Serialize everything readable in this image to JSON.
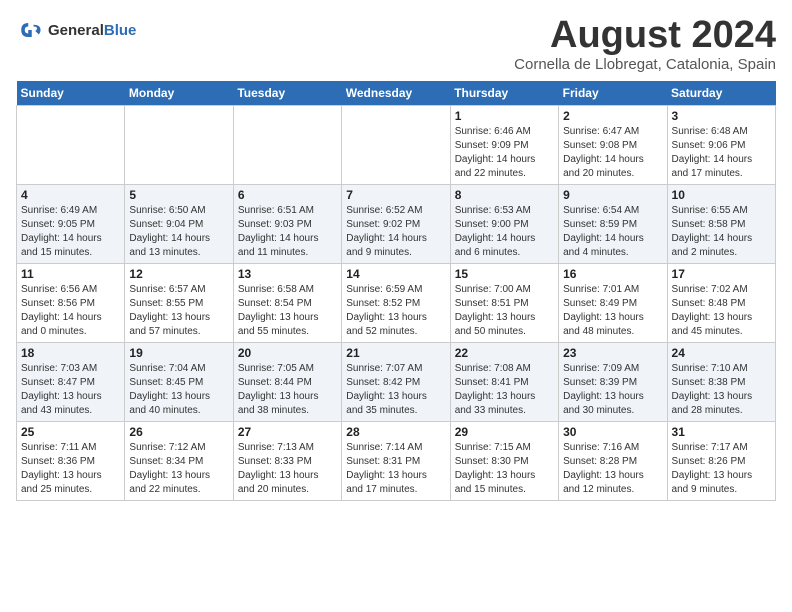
{
  "header": {
    "logo_line1": "General",
    "logo_line2": "Blue",
    "main_title": "August 2024",
    "subtitle": "Cornella de Llobregat, Catalonia, Spain"
  },
  "weekdays": [
    "Sunday",
    "Monday",
    "Tuesday",
    "Wednesday",
    "Thursday",
    "Friday",
    "Saturday"
  ],
  "weeks": [
    [
      {
        "day": "",
        "info": ""
      },
      {
        "day": "",
        "info": ""
      },
      {
        "day": "",
        "info": ""
      },
      {
        "day": "",
        "info": ""
      },
      {
        "day": "1",
        "info": "Sunrise: 6:46 AM\nSunset: 9:09 PM\nDaylight: 14 hours\nand 22 minutes."
      },
      {
        "day": "2",
        "info": "Sunrise: 6:47 AM\nSunset: 9:08 PM\nDaylight: 14 hours\nand 20 minutes."
      },
      {
        "day": "3",
        "info": "Sunrise: 6:48 AM\nSunset: 9:06 PM\nDaylight: 14 hours\nand 17 minutes."
      }
    ],
    [
      {
        "day": "4",
        "info": "Sunrise: 6:49 AM\nSunset: 9:05 PM\nDaylight: 14 hours\nand 15 minutes."
      },
      {
        "day": "5",
        "info": "Sunrise: 6:50 AM\nSunset: 9:04 PM\nDaylight: 14 hours\nand 13 minutes."
      },
      {
        "day": "6",
        "info": "Sunrise: 6:51 AM\nSunset: 9:03 PM\nDaylight: 14 hours\nand 11 minutes."
      },
      {
        "day": "7",
        "info": "Sunrise: 6:52 AM\nSunset: 9:02 PM\nDaylight: 14 hours\nand 9 minutes."
      },
      {
        "day": "8",
        "info": "Sunrise: 6:53 AM\nSunset: 9:00 PM\nDaylight: 14 hours\nand 6 minutes."
      },
      {
        "day": "9",
        "info": "Sunrise: 6:54 AM\nSunset: 8:59 PM\nDaylight: 14 hours\nand 4 minutes."
      },
      {
        "day": "10",
        "info": "Sunrise: 6:55 AM\nSunset: 8:58 PM\nDaylight: 14 hours\nand 2 minutes."
      }
    ],
    [
      {
        "day": "11",
        "info": "Sunrise: 6:56 AM\nSunset: 8:56 PM\nDaylight: 14 hours\nand 0 minutes."
      },
      {
        "day": "12",
        "info": "Sunrise: 6:57 AM\nSunset: 8:55 PM\nDaylight: 13 hours\nand 57 minutes."
      },
      {
        "day": "13",
        "info": "Sunrise: 6:58 AM\nSunset: 8:54 PM\nDaylight: 13 hours\nand 55 minutes."
      },
      {
        "day": "14",
        "info": "Sunrise: 6:59 AM\nSunset: 8:52 PM\nDaylight: 13 hours\nand 52 minutes."
      },
      {
        "day": "15",
        "info": "Sunrise: 7:00 AM\nSunset: 8:51 PM\nDaylight: 13 hours\nand 50 minutes."
      },
      {
        "day": "16",
        "info": "Sunrise: 7:01 AM\nSunset: 8:49 PM\nDaylight: 13 hours\nand 48 minutes."
      },
      {
        "day": "17",
        "info": "Sunrise: 7:02 AM\nSunset: 8:48 PM\nDaylight: 13 hours\nand 45 minutes."
      }
    ],
    [
      {
        "day": "18",
        "info": "Sunrise: 7:03 AM\nSunset: 8:47 PM\nDaylight: 13 hours\nand 43 minutes."
      },
      {
        "day": "19",
        "info": "Sunrise: 7:04 AM\nSunset: 8:45 PM\nDaylight: 13 hours\nand 40 minutes."
      },
      {
        "day": "20",
        "info": "Sunrise: 7:05 AM\nSunset: 8:44 PM\nDaylight: 13 hours\nand 38 minutes."
      },
      {
        "day": "21",
        "info": "Sunrise: 7:07 AM\nSunset: 8:42 PM\nDaylight: 13 hours\nand 35 minutes."
      },
      {
        "day": "22",
        "info": "Sunrise: 7:08 AM\nSunset: 8:41 PM\nDaylight: 13 hours\nand 33 minutes."
      },
      {
        "day": "23",
        "info": "Sunrise: 7:09 AM\nSunset: 8:39 PM\nDaylight: 13 hours\nand 30 minutes."
      },
      {
        "day": "24",
        "info": "Sunrise: 7:10 AM\nSunset: 8:38 PM\nDaylight: 13 hours\nand 28 minutes."
      }
    ],
    [
      {
        "day": "25",
        "info": "Sunrise: 7:11 AM\nSunset: 8:36 PM\nDaylight: 13 hours\nand 25 minutes."
      },
      {
        "day": "26",
        "info": "Sunrise: 7:12 AM\nSunset: 8:34 PM\nDaylight: 13 hours\nand 22 minutes."
      },
      {
        "day": "27",
        "info": "Sunrise: 7:13 AM\nSunset: 8:33 PM\nDaylight: 13 hours\nand 20 minutes."
      },
      {
        "day": "28",
        "info": "Sunrise: 7:14 AM\nSunset: 8:31 PM\nDaylight: 13 hours\nand 17 minutes."
      },
      {
        "day": "29",
        "info": "Sunrise: 7:15 AM\nSunset: 8:30 PM\nDaylight: 13 hours\nand 15 minutes."
      },
      {
        "day": "30",
        "info": "Sunrise: 7:16 AM\nSunset: 8:28 PM\nDaylight: 13 hours\nand 12 minutes."
      },
      {
        "day": "31",
        "info": "Sunrise: 7:17 AM\nSunset: 8:26 PM\nDaylight: 13 hours\nand 9 minutes."
      }
    ]
  ]
}
